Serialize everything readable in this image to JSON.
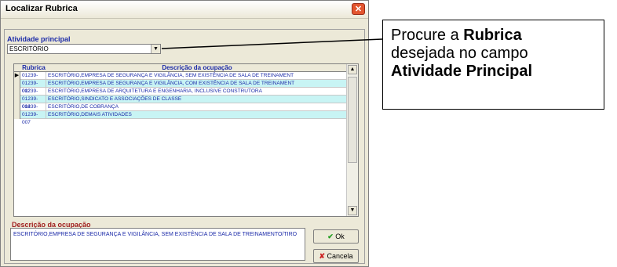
{
  "window": {
    "title": "Localizar Rubrica",
    "close_glyph": "✕"
  },
  "field": {
    "label": "Atividade principal",
    "value": "ESCRITÓRIO"
  },
  "grid": {
    "columns": [
      "Rubrica",
      "Descrição da ocupação"
    ],
    "rows": [
      {
        "code": "01239-001",
        "desc": "ESCRITÓRIO,EMPRESA DE SEGURANÇA E VIGILÂNCIA, SEM EXISTÊNCIA DE SALA DE TREINAMENT",
        "selected": true
      },
      {
        "code": "01239-002",
        "desc": "ESCRITÓRIO,EMPRESA DE SEGURANÇA E VIGILÂNCIA, COM EXISTÊNCIA DE SALA DE TREINAMENT"
      },
      {
        "code": "01239-003",
        "desc": "ESCRITÓRIO,EMPRESA DE ARQUITETURA E ENGENHARIA, INCLUSIVE CONSTRUTORA"
      },
      {
        "code": "01239-004",
        "desc": "ESCRITÓRIO,SINDICATO E ASSOCIAÇÕES DE CLASSE"
      },
      {
        "code": "01239-006",
        "desc": "ESCRITÓRIO,DE COBRANÇA"
      },
      {
        "code": "01239-007",
        "desc": "ESCRITÓRIO,DEMAIS ATIVIDADES"
      }
    ]
  },
  "description": {
    "label": "Descrição da ocupação",
    "text": "ESCRITÓRIO,EMPRESA DE SEGURANÇA E VIGILÂNCIA, SEM EXISTÊNCIA DE SALA DE TREINAMENTO/TIRO"
  },
  "buttons": {
    "ok": "Ok",
    "cancel": "Cancela"
  },
  "callout": {
    "line1_prefix": "Procure a ",
    "line1_bold": "Rubrica",
    "line2": "desejada no campo",
    "line3_bold": "Atividade Principal"
  },
  "colors": {
    "accent": "#1b2aa8",
    "row_alt": "#c8f4f4",
    "ok_check": "#1e9c1e",
    "cancel_x": "#cc2222"
  }
}
